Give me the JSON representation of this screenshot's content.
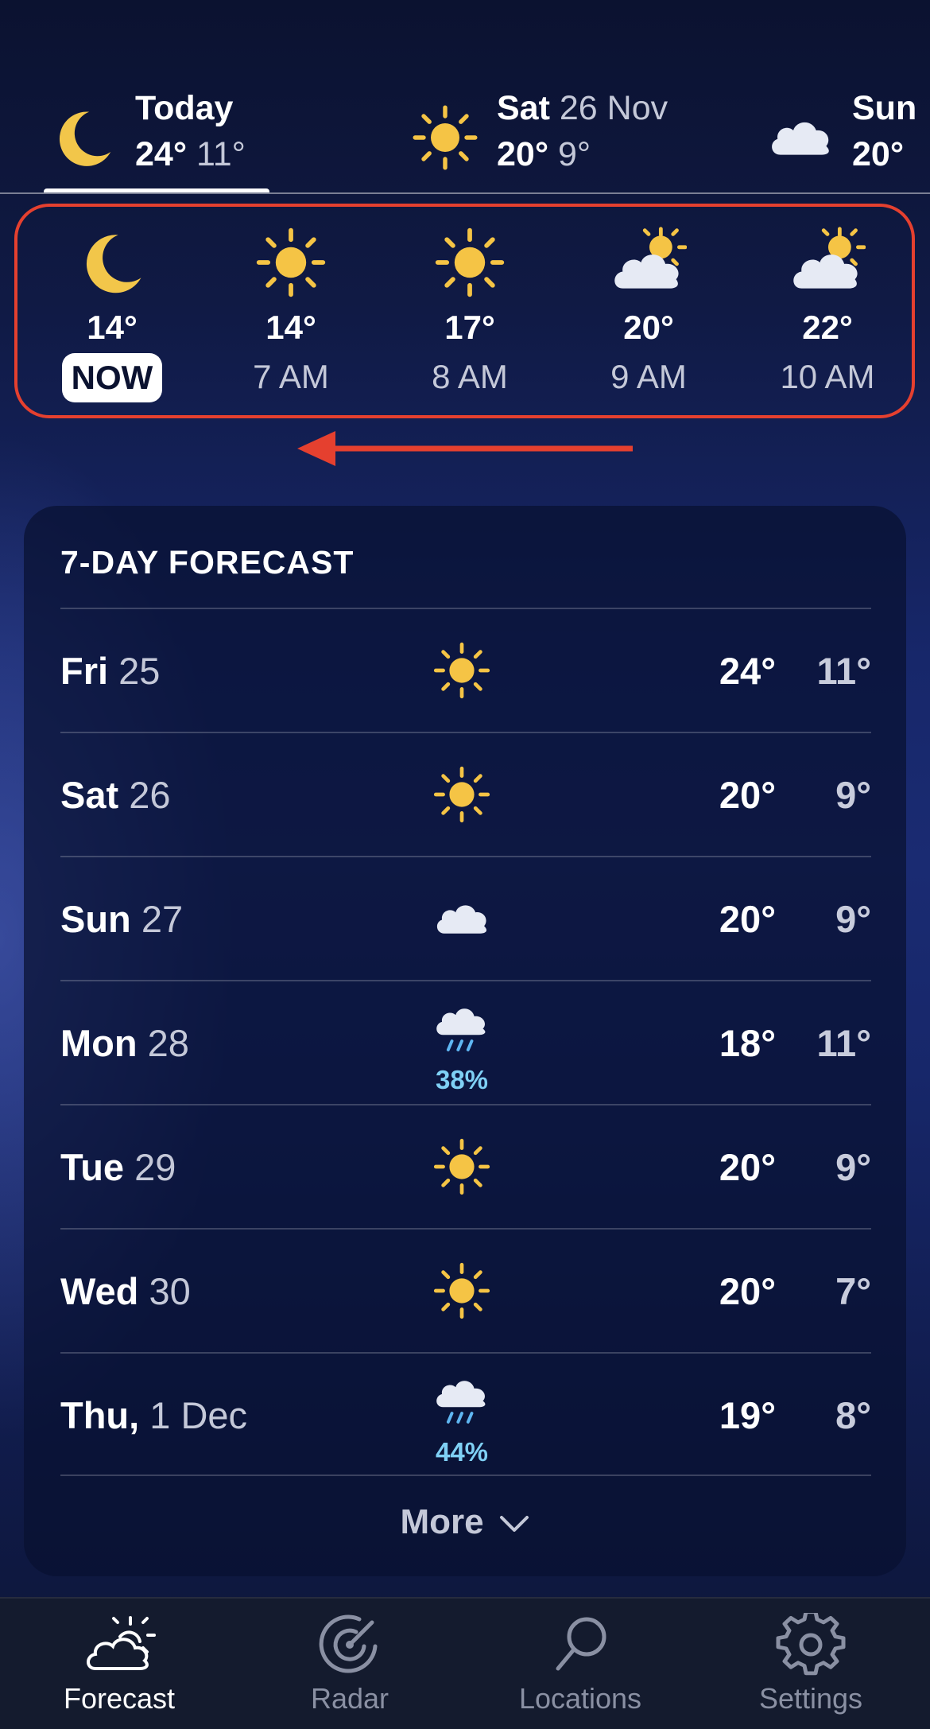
{
  "day_tabs": [
    {
      "day": "Today",
      "date": "",
      "high": "24°",
      "low": "11°",
      "icon": "moon-icon",
      "selected": true
    },
    {
      "day": "Sat",
      "date": "26 Nov",
      "high": "20°",
      "low": "9°",
      "icon": "sun-icon",
      "selected": false
    },
    {
      "day": "Sun",
      "date": "",
      "high": "20°",
      "low": "",
      "icon": "cloud-icon",
      "selected": false
    }
  ],
  "hourly": [
    {
      "temp": "14°",
      "time": "NOW",
      "icon": "moon-icon"
    },
    {
      "temp": "14°",
      "time": "7 AM",
      "icon": "sun-icon"
    },
    {
      "temp": "17°",
      "time": "8 AM",
      "icon": "sun-icon"
    },
    {
      "temp": "20°",
      "time": "9 AM",
      "icon": "partly-cloudy-icon"
    },
    {
      "temp": "22°",
      "time": "10 AM",
      "icon": "partly-cloudy-icon"
    }
  ],
  "forecast": {
    "title": "7-DAY FORECAST",
    "days": [
      {
        "day": "Fri",
        "date": "25",
        "icon": "sun-icon",
        "precip": "",
        "high": "24°",
        "low": "11°"
      },
      {
        "day": "Sat",
        "date": "26",
        "icon": "sun-icon",
        "precip": "",
        "high": "20°",
        "low": "9°"
      },
      {
        "day": "Sun",
        "date": "27",
        "icon": "cloud-icon",
        "precip": "",
        "high": "20°",
        "low": "9°"
      },
      {
        "day": "Mon",
        "date": "28",
        "icon": "rain-icon",
        "precip": "38%",
        "high": "18°",
        "low": "11°"
      },
      {
        "day": "Tue",
        "date": "29",
        "icon": "sun-icon",
        "precip": "",
        "high": "20°",
        "low": "9°"
      },
      {
        "day": "Wed",
        "date": "30",
        "icon": "sun-icon",
        "precip": "",
        "high": "20°",
        "low": "7°"
      },
      {
        "day": "Thu,",
        "date": "1 Dec",
        "icon": "rain-icon",
        "precip": "44%",
        "high": "19°",
        "low": "8°"
      }
    ],
    "more_label": "More"
  },
  "tab_bar": [
    {
      "label": "Forecast",
      "icon": "forecast-icon",
      "active": true
    },
    {
      "label": "Radar",
      "icon": "radar-icon",
      "active": false
    },
    {
      "label": "Locations",
      "icon": "search-icon",
      "active": false
    },
    {
      "label": "Settings",
      "icon": "gear-icon",
      "active": false
    }
  ],
  "colors": {
    "accent_red": "#e5402f",
    "sun_yellow": "#f5c445",
    "precip_blue": "#7fd0f5",
    "tab_bar_bg": "#141b2e"
  }
}
